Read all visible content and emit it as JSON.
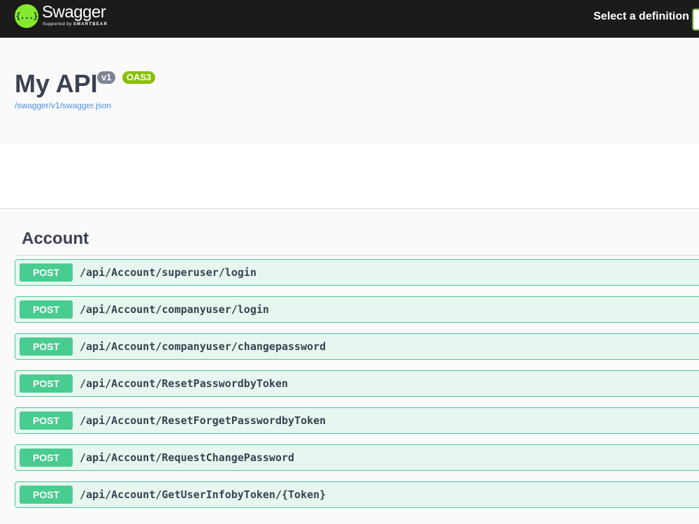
{
  "topbar": {
    "logo_name": "Swagger",
    "logo_sub_prefix": "Supported by ",
    "logo_sub_brand": "SMARTBEAR",
    "logo_glyph": "{...}",
    "select_definition_label": "Select a definition"
  },
  "info": {
    "title": "My API",
    "version_badge": "v1",
    "oas_badge": "OAS3",
    "spec_link": "/swagger/v1/swagger.json"
  },
  "tag": {
    "name": "Account"
  },
  "operations": [
    {
      "method": "POST",
      "path": "/api/Account/superuser/login"
    },
    {
      "method": "POST",
      "path": "/api/Account/companyuser/login"
    },
    {
      "method": "POST",
      "path": "/api/Account/companyuser/changepassword"
    },
    {
      "method": "POST",
      "path": "/api/Account/ResetPasswordbyToken"
    },
    {
      "method": "POST",
      "path": "/api/Account/ResetForgetPasswordbyToken"
    },
    {
      "method": "POST",
      "path": "/api/Account/RequestChangePassword"
    },
    {
      "method": "POST",
      "path": "/api/Account/GetUserInfobyToken/{Token}"
    }
  ],
  "colors": {
    "topbar_bg": "#1b1b1b",
    "post_accent": "#49cc90",
    "logo_green": "#85ea2d"
  }
}
